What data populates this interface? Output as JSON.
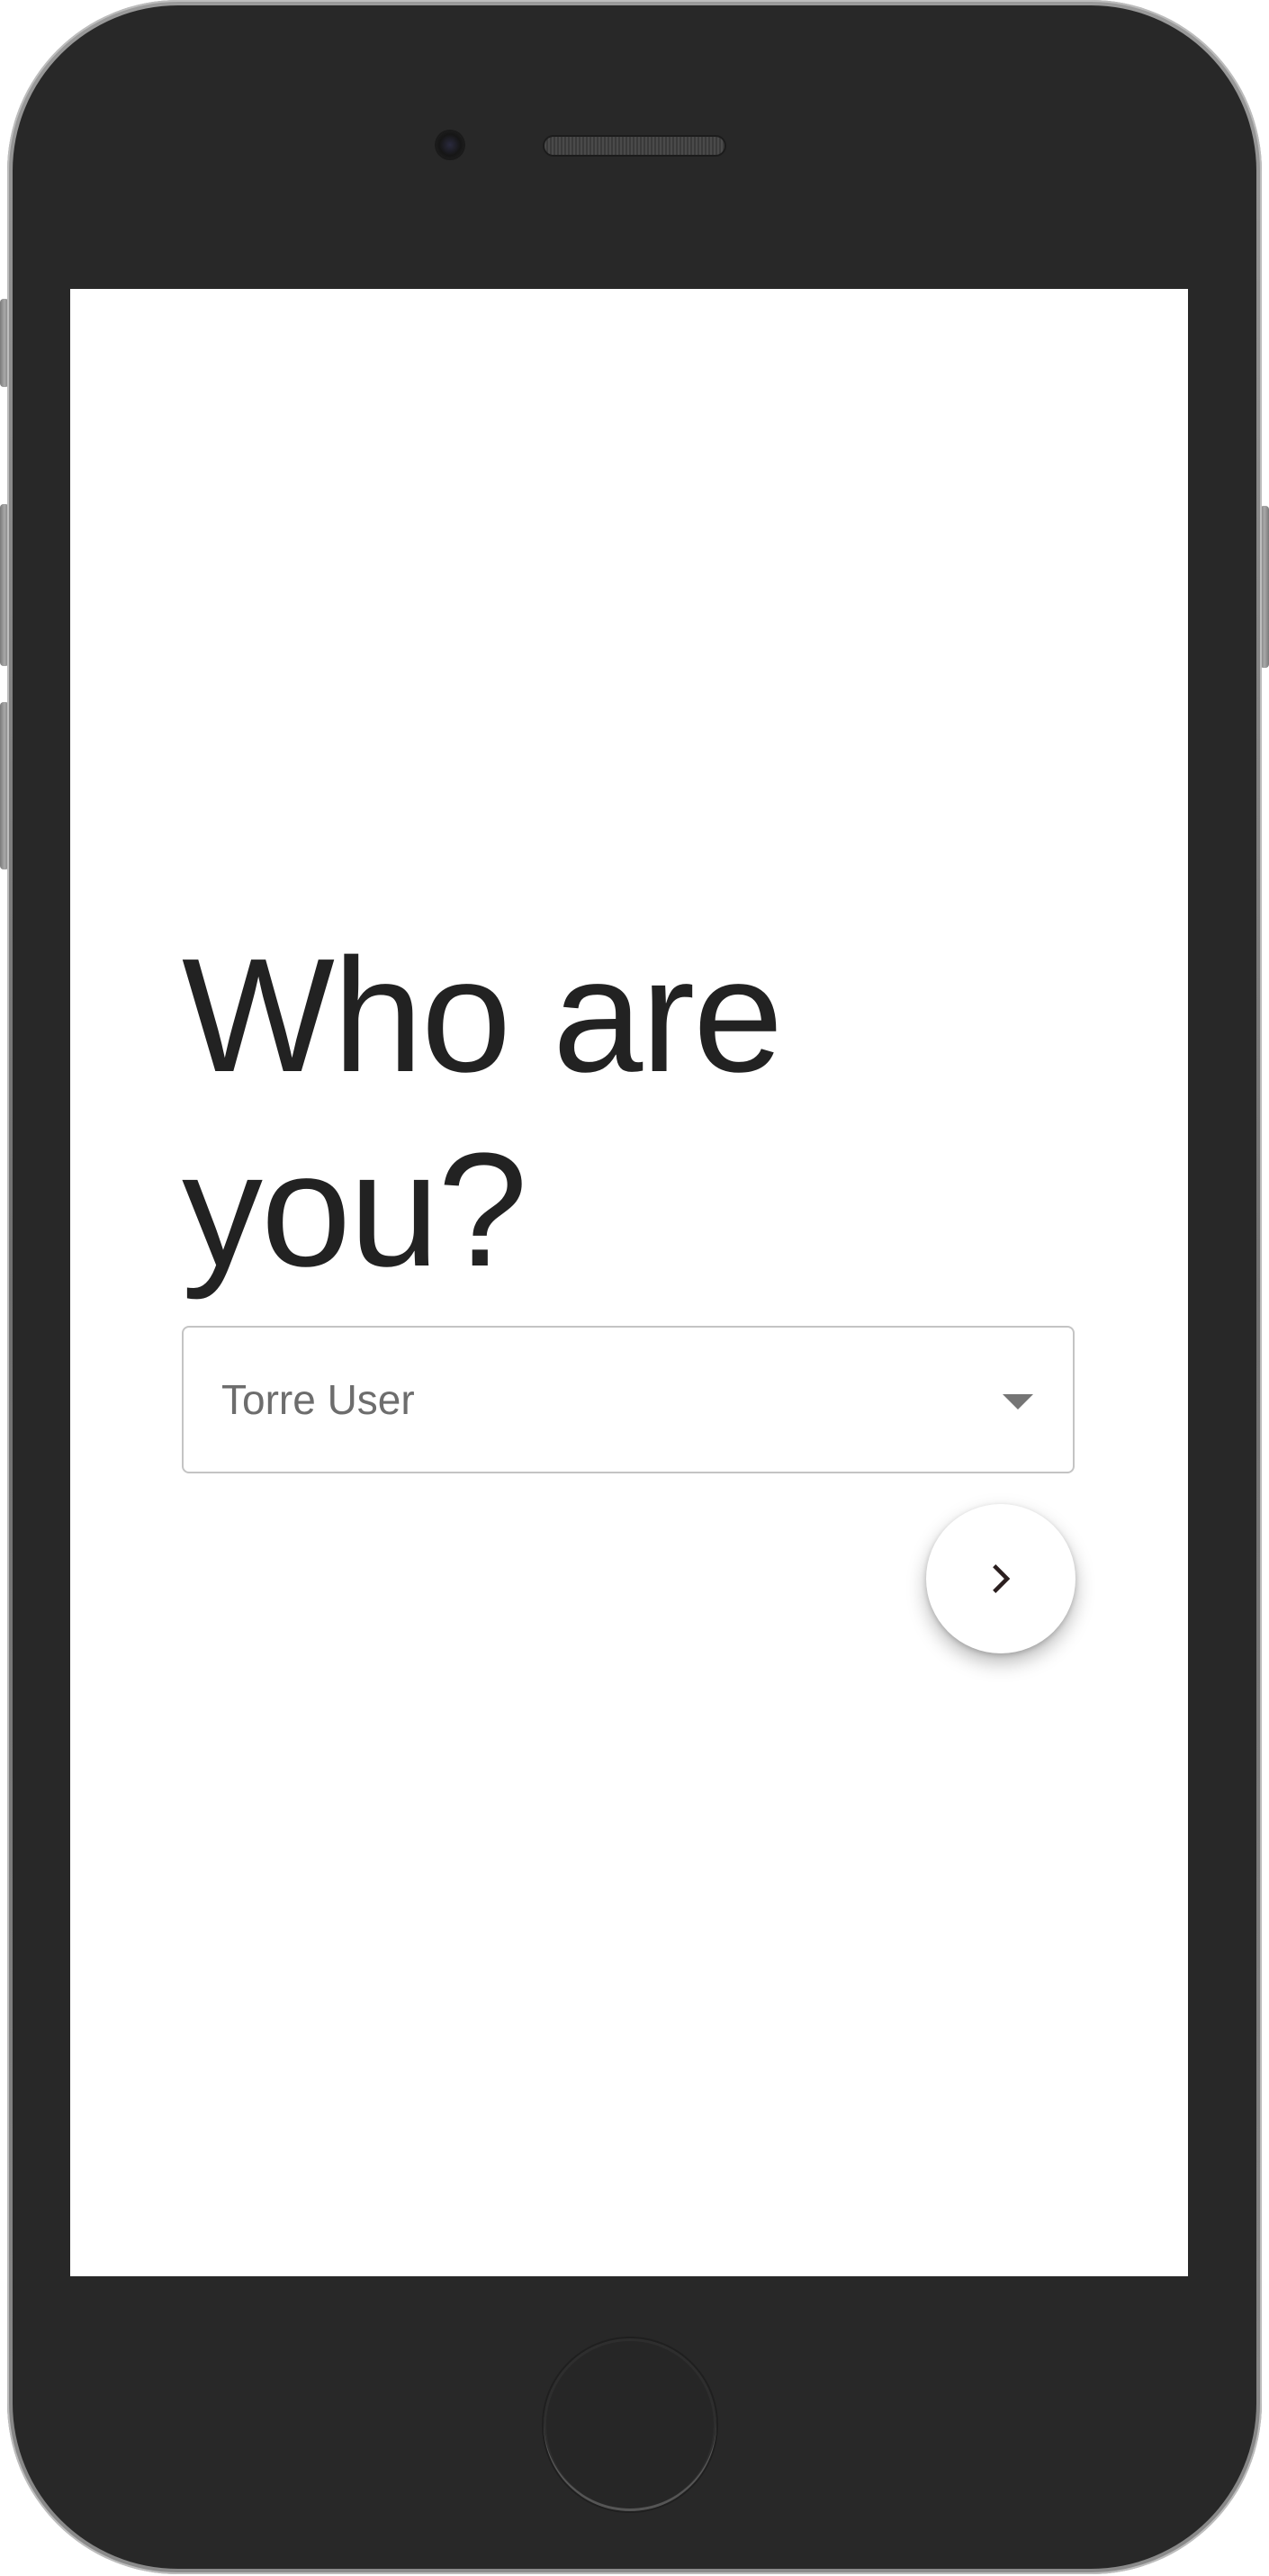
{
  "screen": {
    "heading": "Who are\nyou?",
    "select": {
      "value": "Torre User"
    },
    "next_button": {
      "icon": "chevron-right-icon"
    }
  },
  "device": {
    "frame": "iphone",
    "icons": [
      "camera-icon",
      "speaker-grille",
      "home-button"
    ]
  },
  "colors": {
    "heading_text": "#222222",
    "select_text": "#6d6d6d",
    "select_border": "#c4c4c4",
    "device_body": "#282828",
    "icon_dark": "#2b1f1f"
  }
}
